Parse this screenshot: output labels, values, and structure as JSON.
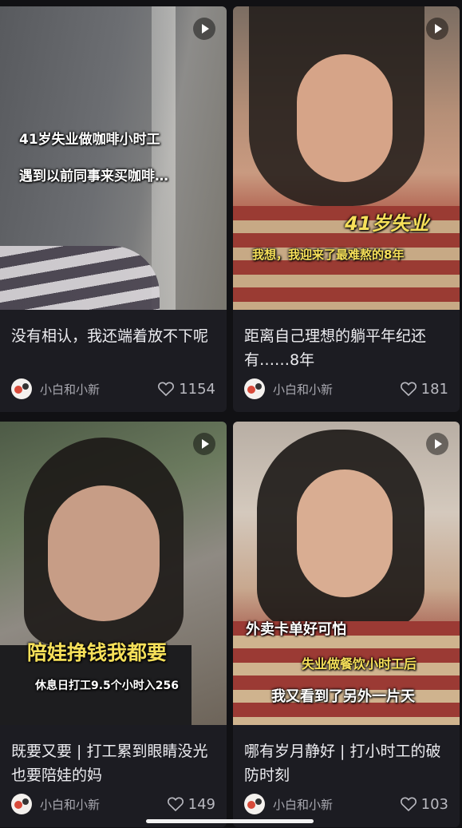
{
  "cards": [
    {
      "title": "没有相认，我还端着放不下呢",
      "author": "小白和小新",
      "likes": "1154",
      "overlay_lines": [
        "41岁失业做咖啡小时工",
        "遇到以前同事来买咖啡…"
      ]
    },
    {
      "title": "距离自己理想的躺平年纪还有……8年",
      "author": "小白和小新",
      "likes": "181",
      "overlay_lines": [
        "41岁失业",
        "我想，我迎来了最难熬的8年"
      ]
    },
    {
      "title": "既要又要 | 打工累到眼睛没光也要陪娃的妈",
      "author": "小白和小新",
      "likes": "149",
      "overlay_lines": [
        "陪娃挣钱我都要",
        "休息日打工9.5个小时入256"
      ]
    },
    {
      "title": "哪有岁月静好 | 打小时工的破防时刻",
      "author": "小白和小新",
      "likes": "103",
      "overlay_lines": [
        "外卖卡单好可怕",
        "失业做餐饮小时工后",
        "我又看到了另外一片天"
      ]
    }
  ],
  "icons": {
    "play": "play-icon",
    "like": "heart-icon",
    "avatar": "avatar"
  },
  "colors": {
    "background": "#111114",
    "card": "#1c1c22",
    "highlight_yellow": "#f6e05a"
  }
}
